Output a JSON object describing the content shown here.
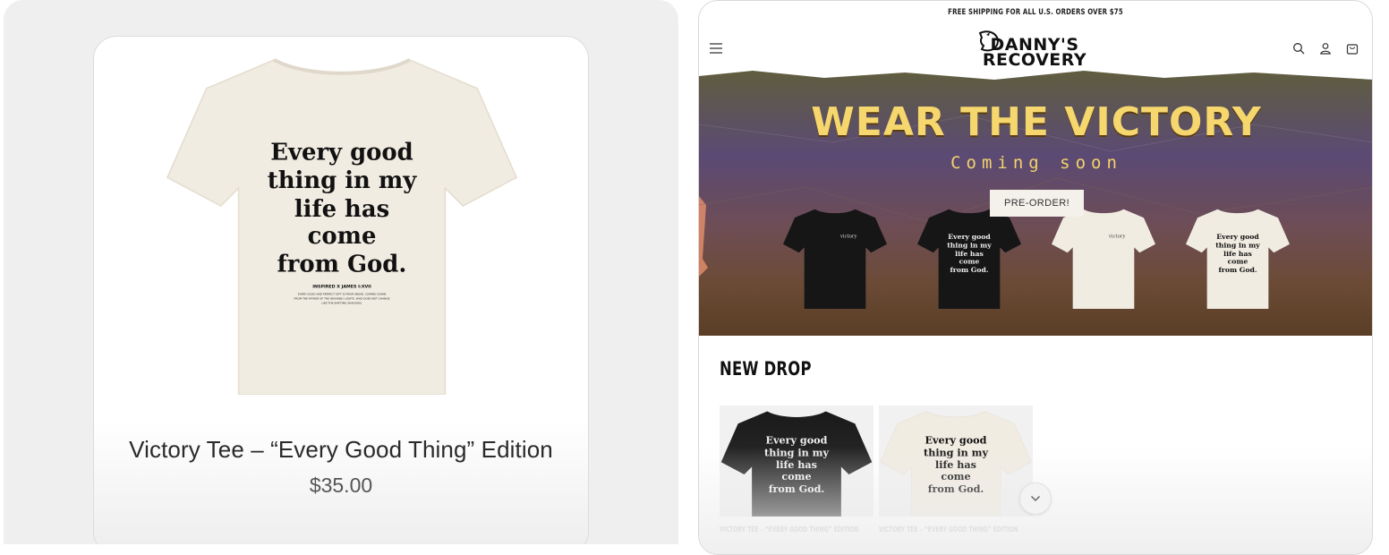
{
  "product_card": {
    "title": "Victory Tee – “Every Good Thing” Edition",
    "price": "$35.00",
    "shirt_print": {
      "line1": "Every good",
      "line2": "thing in my",
      "line3": "life has",
      "line4": "come",
      "line5": "from God.",
      "ref": "INSPIRED X JAMES I:XVII",
      "verse1": "EVERY GOOD AND PERFECT GIFT IS FROM ABOVE, COMING DOWN",
      "verse2": "FROM THE FATHER OF THE HEAVENLY LIGHTS, WHO DOES NOT CHANGE",
      "verse3": "LIKE THE SHIFTING SHADOWS."
    }
  },
  "store": {
    "announcement": "FREE SHIPPING FOR ALL U.S. ORDERS OVER $75",
    "logo_line1": "DANNY'S",
    "logo_line2": "RECOVERY",
    "header_icons": [
      "menu-icon",
      "search-icon",
      "account-icon",
      "cart-icon"
    ],
    "hero": {
      "title": "WEAR THE VICTORY",
      "subtitle": "Coming soon",
      "button": "PRE-ORDER!",
      "front_print": "victory"
    },
    "new_drop": {
      "heading": "NEW DROP",
      "items": [
        {
          "label": "VICTORY TEE – “EVERY GOOD THING” EDITION",
          "color": "black"
        },
        {
          "label": "VICTORY TEE – “EVERY GOOD THING” EDITION",
          "color": "cream"
        }
      ]
    }
  },
  "colors": {
    "cream_tee": "#f1ece2",
    "black_tee": "#1c1c1c",
    "hero_title": "#f5d76e",
    "panel_bg": "#efefef"
  }
}
